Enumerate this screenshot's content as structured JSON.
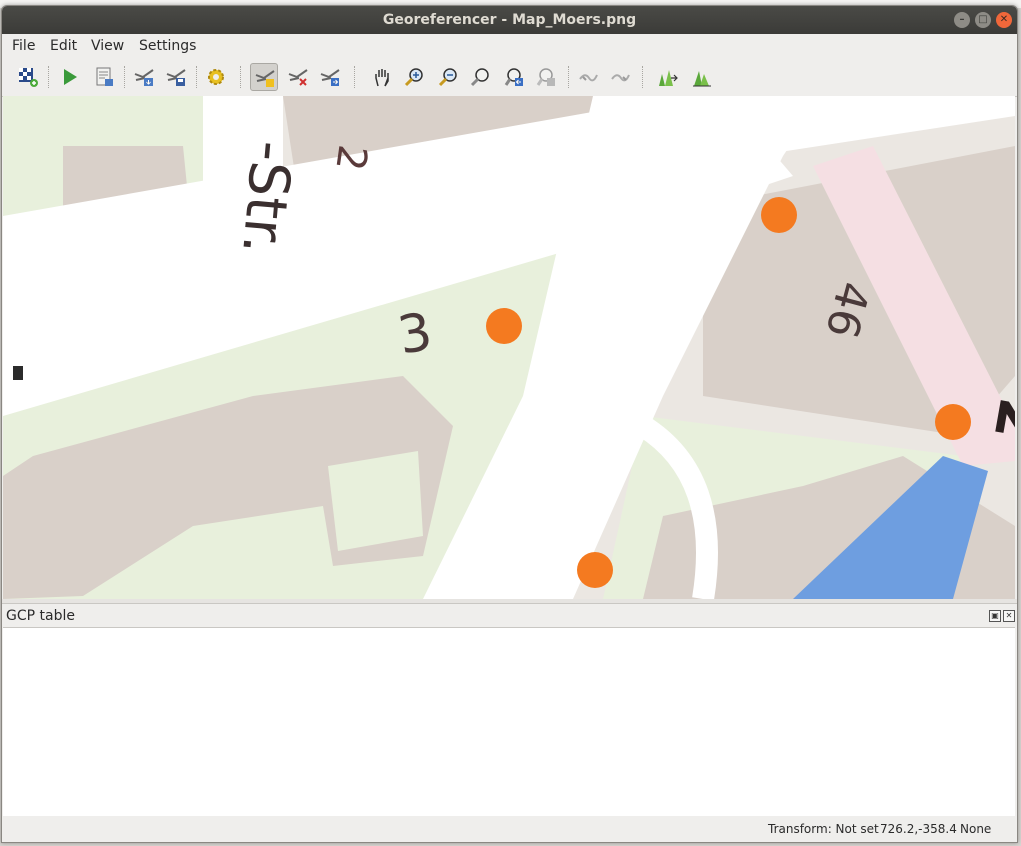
{
  "window": {
    "title": "Georeferencer - Map_Moers.png",
    "controls": {
      "minimize": "–",
      "maximize": "□",
      "close": "✕"
    }
  },
  "menu": {
    "file": "File",
    "edit": "Edit",
    "view": "View",
    "settings": "Settings"
  },
  "toolbar": {
    "icons": [
      "open-raster-icon",
      "start-georeferencing-icon",
      "generate-gdal-script-icon",
      "load-gcp-points-icon",
      "save-gcp-points-icon",
      "transformation-settings-icon",
      "add-point-icon",
      "delete-point-icon",
      "move-gcp-point-icon",
      "pan-icon",
      "zoom-in-icon",
      "zoom-out-icon",
      "zoom-to-layer-icon",
      "zoom-last-icon",
      "zoom-next-icon",
      "link-georeferencer-to-qgis-icon",
      "link-qgis-to-georeferencer-icon",
      "full-histogram-stretch-icon",
      "local-histogram-stretch-icon"
    ],
    "active_tool": "add-point-icon"
  },
  "map": {
    "labels": {
      "street_fragment": "-Str.",
      "house_2": "2",
      "house_3": "3",
      "house_46": "46",
      "edge_number": "2"
    },
    "colors": {
      "road": "#ffffff",
      "building": "#d9d0c9",
      "green": "#e8f0dc",
      "background": "#ebe7e2",
      "water": "#6e9ee0",
      "pedestrian": "#f5dfe3",
      "gcp_point": "#f47a20"
    },
    "gcp_point_count": 4
  },
  "gcp_panel": {
    "title": "GCP table",
    "float_button": "▣",
    "close_button": "✕"
  },
  "status": {
    "transform": "Transform: Not set",
    "coordinates": "726.2,-358.4",
    "crs": "None"
  }
}
